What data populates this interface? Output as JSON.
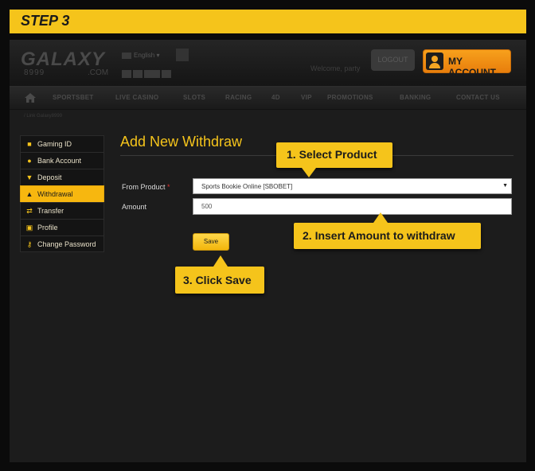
{
  "step_label": "STEP 3",
  "site": {
    "logo_text": "GALAXY",
    "logo_number": "8999",
    "logo_domain": ".COM",
    "language": "English",
    "welcome_text": "Welcome, party",
    "logout_label": "LOGOUT",
    "my_account_label": "MY ACCOUNT"
  },
  "nav": {
    "items": [
      "SPORTSBET",
      "LIVE CASINO",
      "SLOTS",
      "RACING",
      "4D",
      "VIP",
      "PROMOTIONS",
      "BANKING",
      "CONTACT US"
    ]
  },
  "breadcrumb": "/ Link Galaxy8999",
  "sidebar": {
    "items": [
      {
        "label": "Gaming ID",
        "icon": "gamepad-icon",
        "active": false
      },
      {
        "label": "Bank Account",
        "icon": "coin-icon",
        "active": false
      },
      {
        "label": "Deposit",
        "icon": "download-icon",
        "active": false
      },
      {
        "label": "Withdrawal",
        "icon": "upload-icon",
        "active": true
      },
      {
        "label": "Transfer",
        "icon": "transfer-icon",
        "active": false
      },
      {
        "label": "Profile",
        "icon": "profile-icon",
        "active": false
      },
      {
        "label": "Change Password",
        "icon": "key-icon",
        "active": false
      }
    ]
  },
  "form": {
    "title": "Add New Withdraw",
    "from_product_label": "From Product",
    "required_mark": "*",
    "from_product_value": "Sports Bookie Online [SBOBET]",
    "amount_label": "Amount",
    "amount_value": "500",
    "save_label": "Save"
  },
  "callouts": {
    "select_product": "1. Select Product",
    "insert_amount": "2. Insert Amount to withdraw",
    "click_save": "3. Click Save"
  },
  "colors": {
    "accent": "#f5c41b",
    "background": "#1c1c1c",
    "active_tab": "#f7b70f"
  }
}
